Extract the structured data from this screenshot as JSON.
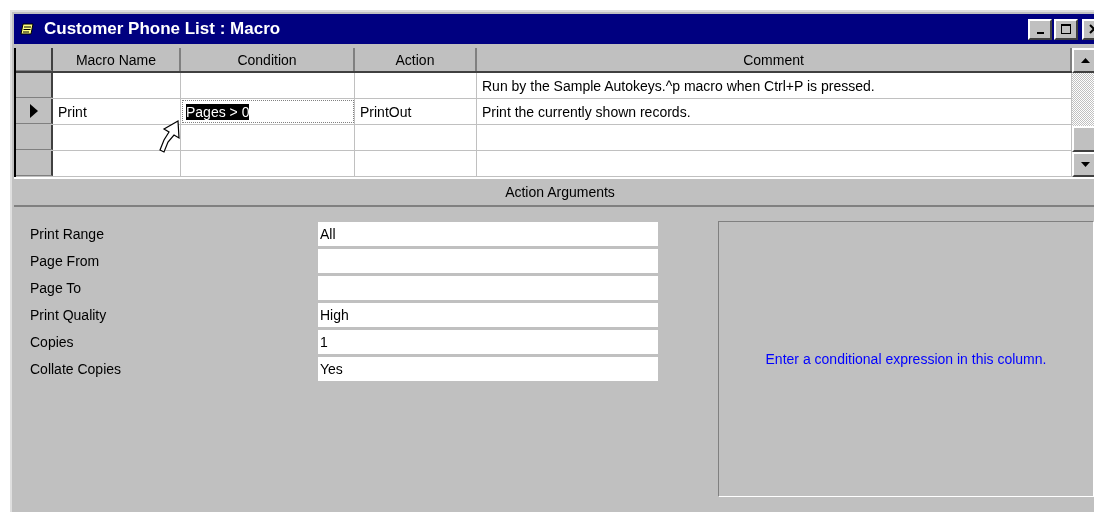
{
  "window": {
    "title": "Customer Phone List : Macro"
  },
  "table": {
    "columns": [
      "Macro Name",
      "Condition",
      "Action",
      "Comment"
    ],
    "rows": [
      {
        "current": false,
        "condition_selected": false,
        "comment": "Run by the Sample Autokeys.^p macro when Ctrl+P is pressed."
      },
      {
        "current": true,
        "condition_selected": true,
        "macro_name": "Print",
        "condition": "Pages > 0",
        "action": "PrintOut",
        "comment": "Print the currently shown records."
      },
      {
        "current": false,
        "condition_selected": false
      },
      {
        "current": false,
        "condition_selected": false
      }
    ]
  },
  "action_arguments": {
    "title": "Action Arguments",
    "fields": [
      {
        "label": "Print Range",
        "value": "All"
      },
      {
        "label": "Page From"
      },
      {
        "label": "Page To"
      },
      {
        "label": "Print Quality",
        "value": "High"
      },
      {
        "label": "Copies",
        "value": "1"
      },
      {
        "label": "Collate Copies",
        "value": "Yes"
      }
    ],
    "help_text": "Enter a conditional expression in this column."
  }
}
